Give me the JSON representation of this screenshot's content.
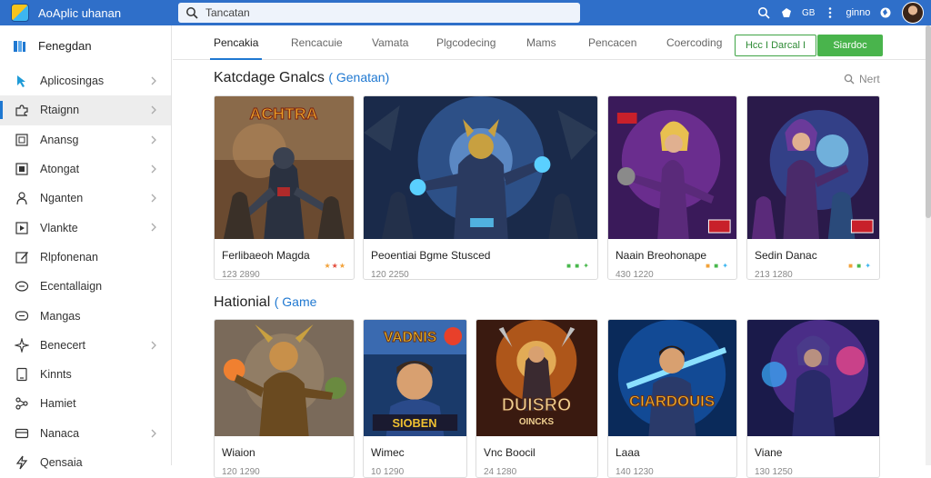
{
  "app": {
    "title": "AoAplic uhanan"
  },
  "search": {
    "value": "Tancatan"
  },
  "top_icons": {
    "badge_text": "GB",
    "user_name": "ginno"
  },
  "sidebar": {
    "header": "Fenegdan",
    "items": [
      {
        "label": "Aplicosingas",
        "icon": "cursor-icon",
        "chevron": true
      },
      {
        "label": "Rtaignn",
        "icon": "puzzle-icon",
        "chevron": true,
        "active": true
      },
      {
        "label": "Anansg",
        "icon": "frame-icon",
        "chevron": true
      },
      {
        "label": "Atongat",
        "icon": "square-icon",
        "chevron": true
      },
      {
        "label": "Nganten",
        "icon": "person-icon",
        "chevron": true
      },
      {
        "label": "Vlankte",
        "icon": "play-icon",
        "chevron": true
      },
      {
        "label": "Rlpfonenan",
        "icon": "edit-icon",
        "chevron": false
      },
      {
        "label": "Ecentallaign",
        "icon": "bubble-icon",
        "chevron": false
      },
      {
        "label": "Mangas",
        "icon": "chat-icon",
        "chevron": false
      },
      {
        "label": "Benecert",
        "icon": "sparkle-icon",
        "chevron": true
      },
      {
        "label": "Kinnts",
        "icon": "tablet-icon",
        "chevron": false
      },
      {
        "label": "Hamiet",
        "icon": "network-icon",
        "chevron": false
      },
      {
        "label": "Nanaca",
        "icon": "card-icon",
        "chevron": true
      },
      {
        "label": "Qensaia",
        "icon": "bolt-icon",
        "chevron": false
      }
    ]
  },
  "tabs": [
    "Pencakia",
    "Rencacuie",
    "Vamata",
    "Plgcodecing",
    "Mams",
    "Pencacen",
    "Coercoding"
  ],
  "actions": {
    "outline_label": "Hcc I Darcal I",
    "solid_label": "Siardoc"
  },
  "section1": {
    "title": "Katcdage Gnalcs",
    "accent": "( Genatan)",
    "see_more": "Nert"
  },
  "section2": {
    "title": "Hationial",
    "accent": "( Game"
  },
  "row1": [
    {
      "title": "Ferlibaeoh Magda",
      "sub": "123 2890",
      "rating_colors": [
        "#f2a23a",
        "#e34c3c",
        "#f2a23a"
      ]
    },
    {
      "title": "Peoentiai Bgme Stusced",
      "sub": "120 2250",
      "rating_colors": [
        "#48b84c",
        "#48b84c",
        "#48b84c"
      ]
    },
    {
      "title": "Naain Breohonape",
      "sub": "430 1220",
      "rating_colors": [
        "#f2a23a",
        "#48b84c",
        "#3db6f0"
      ]
    },
    {
      "title": "Sedin Danac",
      "sub": "213 1280",
      "rating_colors": [
        "#f2a23a",
        "#48b84c",
        "#3db6f0"
      ]
    }
  ],
  "row2": [
    {
      "title": "Wiaion",
      "sub": "120 1290"
    },
    {
      "title": "Wimec",
      "sub": "10 1290"
    },
    {
      "title": "Vnc Boocil",
      "sub": "24 1280"
    },
    {
      "title": "Laaa",
      "sub": "140 1230"
    },
    {
      "title": "Viane",
      "sub": "130 1250"
    }
  ],
  "colors": {
    "topbar": "#2f6fc9",
    "accent": "#1f78d1",
    "green": "#49b44c",
    "badge_red": "#c8202a"
  }
}
